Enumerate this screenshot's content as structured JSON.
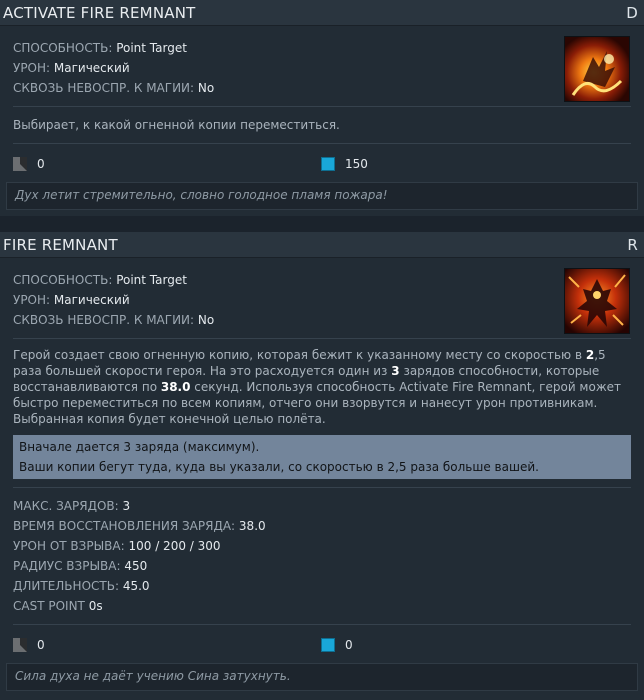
{
  "abilities": [
    {
      "title": "ACTIVATE FIRE REMNANT",
      "hotkey": "D",
      "stats": [
        {
          "label": "СПОСОБНОСТЬ:",
          "value": "Point Target"
        },
        {
          "label": "УРОН:",
          "value": "Магический"
        },
        {
          "label": "СКВОЗЬ НЕВОСПР. К МАГИИ:",
          "value": "No"
        }
      ],
      "description": "Выбирает, к какой огненной копии переместиться.",
      "cooldown": "0",
      "mana": "150",
      "lore": "Дух летит стремительно, словно голодное пламя пожара!",
      "icon": "activate-fire-remnant-icon"
    },
    {
      "title": "FIRE REMNANT",
      "hotkey": "R",
      "stats": [
        {
          "label": "СПОСОБНОСТЬ:",
          "value": "Point Target"
        },
        {
          "label": "УРОН:",
          "value": "Магический"
        },
        {
          "label": "СКВОЗЬ НЕВОСПР. К МАГИИ:",
          "value": "No"
        }
      ],
      "description_parts": [
        "Герой создает свою огненную копию, которая бежит к указанному месту со скоростью в ",
        "2",
        ",5 раза большей скорости героя. На это расходуется один из ",
        "3",
        " зарядов способности, которые восстанавливаются по ",
        "38.0",
        " секунд. Используя способность Activate Fire Remnant, герой может быстро переместиться по всем копиям, отчего они взорвутся и нанесут урон противникам. Выбранная копия будет конечной целью полёта."
      ],
      "notes": [
        "Вначале дается 3 заряда (максимум).",
        "Ваши копии бегут туда, куда вы указали, со скоростью в 2,5 раза больше вашей."
      ],
      "attributes": [
        {
          "label": "МАКС. ЗАРЯДОВ:",
          "value": "3"
        },
        {
          "label": "ВРЕМЯ ВОССТАНОВЛЕНИЯ ЗАРЯДА:",
          "value": "38.0"
        },
        {
          "label": "УРОН ОТ ВЗРЫВА:",
          "value": "100 / 200 / 300"
        },
        {
          "label": "РАДИУС ВЗРЫВА:",
          "value": "450"
        },
        {
          "label": "ДЛИТЕЛЬНОСТЬ:",
          "value": "45.0"
        },
        {
          "label": "CAST POINT",
          "value": "0s"
        }
      ],
      "cooldown": "0",
      "mana": "0",
      "lore": "Сила духа не даёт учению Сина затухнуть.",
      "icon": "fire-remnant-icon"
    }
  ],
  "colors": {
    "mana": "#19a7d8",
    "header_bg": "#2a353f",
    "note_bg": "#73859b"
  }
}
